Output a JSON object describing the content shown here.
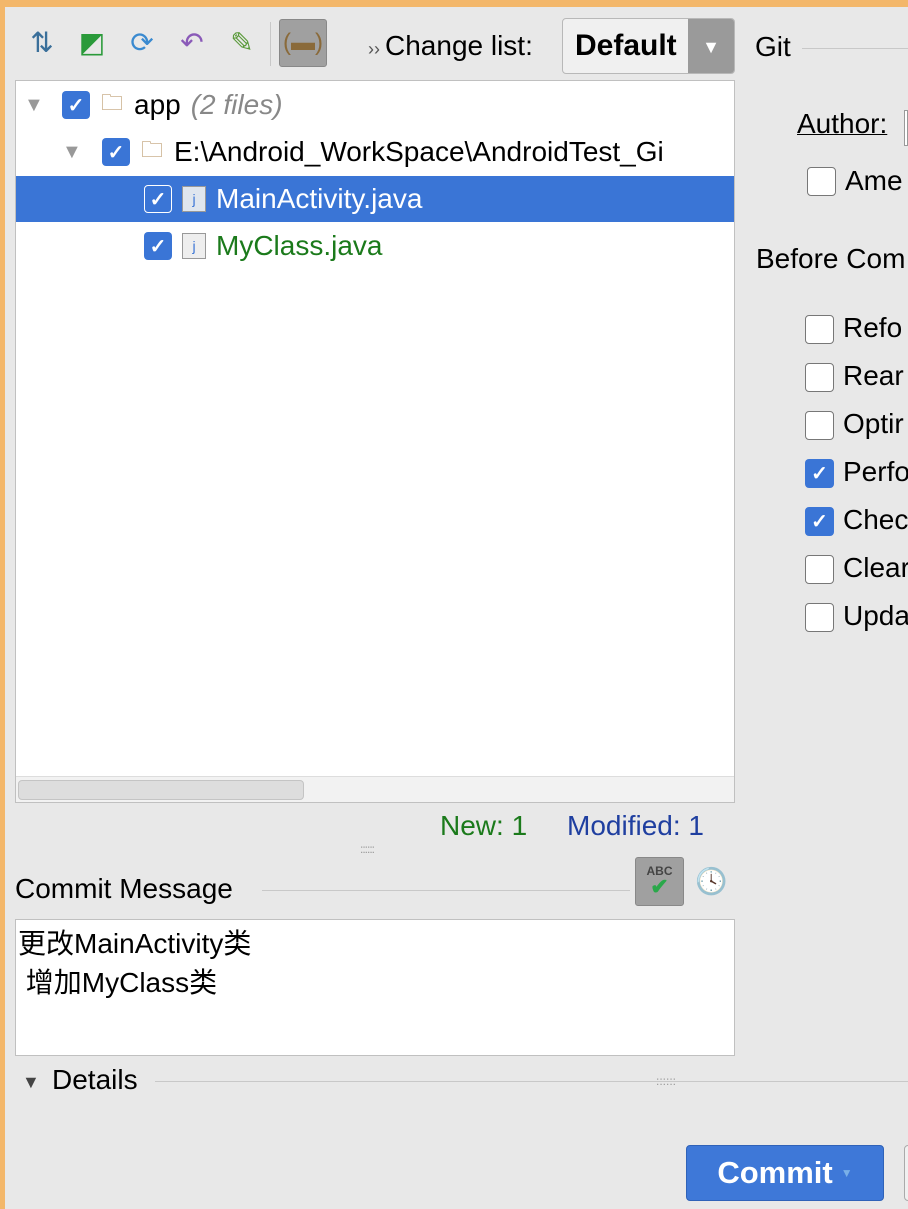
{
  "toolbar": {
    "icons": [
      "show-diff-icon",
      "move-to-changelist-icon",
      "refresh-icon",
      "rollback-icon",
      "edit-source-icon",
      "group-by-directory-icon"
    ],
    "change_list_label": "Change list:",
    "change_list_value": "Default"
  },
  "tree": {
    "rows": [
      {
        "label": "app",
        "suffix": "(2 files)",
        "checked": true
      },
      {
        "label": "E:\\Android_WorkSpace\\AndroidTest_Gi",
        "checked": true
      },
      {
        "label": "MainActivity.java",
        "checked": true,
        "selected": true,
        "status": "modified"
      },
      {
        "label": "MyClass.java",
        "checked": true,
        "status": "new"
      }
    ]
  },
  "summary": {
    "new": "New: 1",
    "modified": "Modified: 1"
  },
  "commit_message": {
    "label": "Commit Message",
    "text": "更改MainActivity类\n 增加MyClass类",
    "spellcheck_label": "ABC"
  },
  "details": {
    "label": "Details"
  },
  "git": {
    "title": "Git",
    "author_label": "Author:",
    "amend_label": "Ame",
    "before_commit_label": "Before Com",
    "options": [
      {
        "label": "Refo",
        "checked": false
      },
      {
        "label": "Rear",
        "checked": false
      },
      {
        "label": "Optir",
        "checked": false
      },
      {
        "label": "Perfo",
        "checked": true
      },
      {
        "label": "Chec",
        "checked": true
      },
      {
        "label": "Clear",
        "checked": false
      },
      {
        "label": "Upda",
        "checked": false
      }
    ]
  },
  "buttons": {
    "commit": "Commit"
  },
  "colors": {
    "accent": "#3a75d6",
    "new": "#1b7a1b",
    "modified": "#1f3fa0",
    "window_border": "#f3b76a"
  }
}
